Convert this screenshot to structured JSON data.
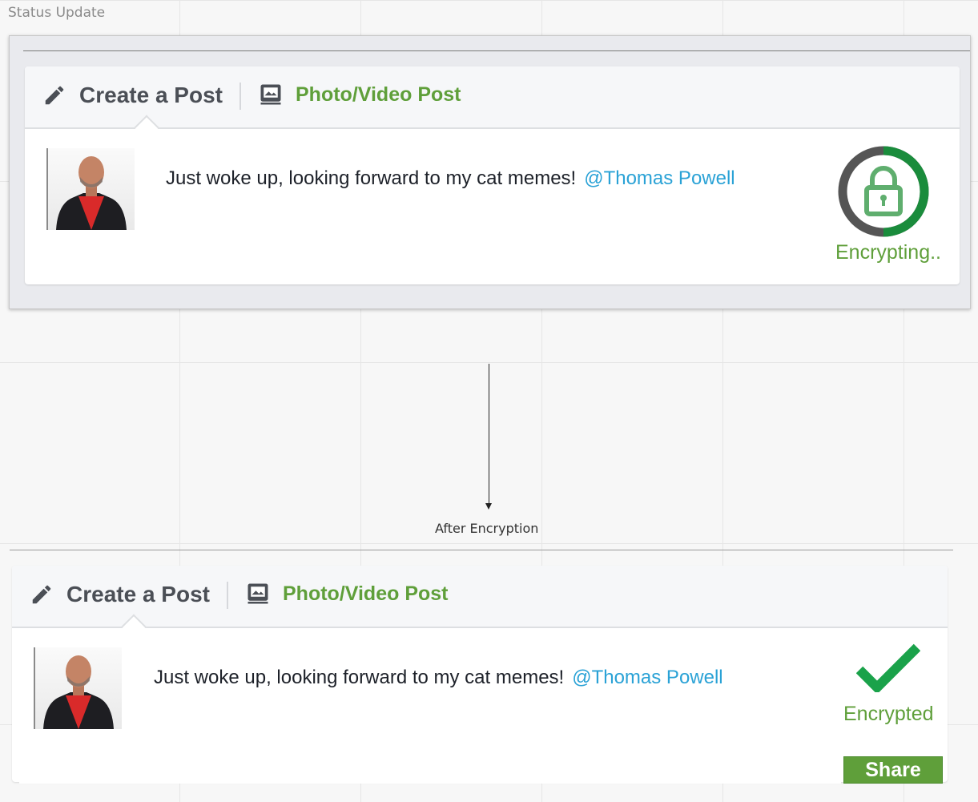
{
  "frame": {
    "label": "Status Update"
  },
  "connector": {
    "label": "After Encryption"
  },
  "posts": [
    {
      "tabs": {
        "create": "Create a Post",
        "photo": "Photo/Video Post"
      },
      "text": "Just woke up, looking forward to my cat memes!",
      "mention": "@Thomas Powell",
      "status": "Encrypting..",
      "status_icon": "padlock-progress-ring-icon"
    },
    {
      "tabs": {
        "create": "Create a Post",
        "photo": "Photo/Video Post"
      },
      "text": "Just woke up, looking forward to my cat memes!",
      "mention": "@Thomas Powell",
      "status": "Encrypted",
      "status_icon": "checkmark-icon",
      "share_label": "Share"
    }
  ],
  "colors": {
    "green": "#5f9f3a",
    "mention": "#2aa2d6",
    "ring_dark": "#555555",
    "ring_green": "#1a8c3c"
  }
}
